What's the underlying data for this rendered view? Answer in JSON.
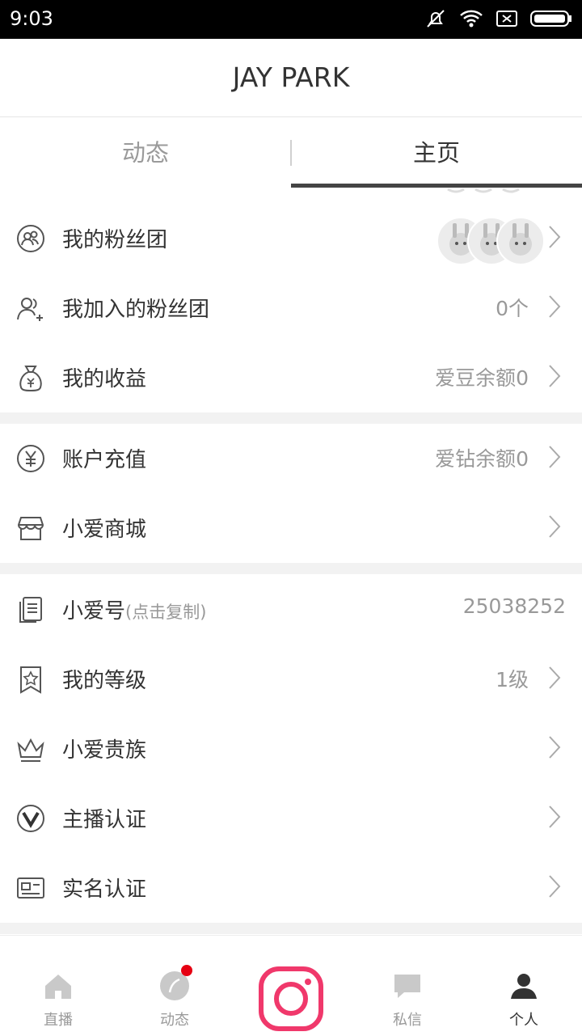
{
  "status_bar": {
    "time": "9:03"
  },
  "header": {
    "title": "JAY PARK"
  },
  "tabs": [
    {
      "label": "动态"
    },
    {
      "label": "主页"
    }
  ],
  "menu": [
    {
      "id": "fan-club",
      "icon": "fan-club-icon",
      "label": "我的粉丝团",
      "value": ""
    },
    {
      "id": "joined-fan-club",
      "icon": "add-group-icon",
      "label": "我加入的粉丝团",
      "value": "0个"
    },
    {
      "id": "earnings",
      "icon": "money-bag-icon",
      "label": "我的收益",
      "value": "爱豆余额0"
    },
    {
      "id": "recharge",
      "icon": "yuan-icon",
      "label": "账户充值",
      "value": "爱钻余额0"
    },
    {
      "id": "mall",
      "icon": "store-icon",
      "label": "小爱商城",
      "value": ""
    },
    {
      "id": "account-id",
      "icon": "document-icon",
      "label": "小爱号",
      "sub": "(点击复制)",
      "value": "25038252"
    },
    {
      "id": "level",
      "icon": "star-bookmark-icon",
      "label": "我的等级",
      "value": "1级"
    },
    {
      "id": "nobility",
      "icon": "crown-icon",
      "label": "小爱贵族",
      "value": ""
    },
    {
      "id": "host-verify",
      "icon": "v-badge-icon",
      "label": "主播认证",
      "value": ""
    },
    {
      "id": "realname",
      "icon": "id-card-icon",
      "label": "实名认证",
      "value": ""
    }
  ],
  "bottom_nav": [
    {
      "label": "直播",
      "icon": "home-icon"
    },
    {
      "label": "动态",
      "icon": "leaf-icon",
      "badge": true
    },
    {
      "label": "",
      "icon": "camera-icon"
    },
    {
      "label": "私信",
      "icon": "message-icon"
    },
    {
      "label": "个人",
      "icon": "person-icon",
      "active": true
    }
  ],
  "colors": {
    "accent": "#f0386b",
    "badge": "#e60012",
    "text": "#333333",
    "muted": "#999999",
    "separator": "#f2f2f2"
  }
}
